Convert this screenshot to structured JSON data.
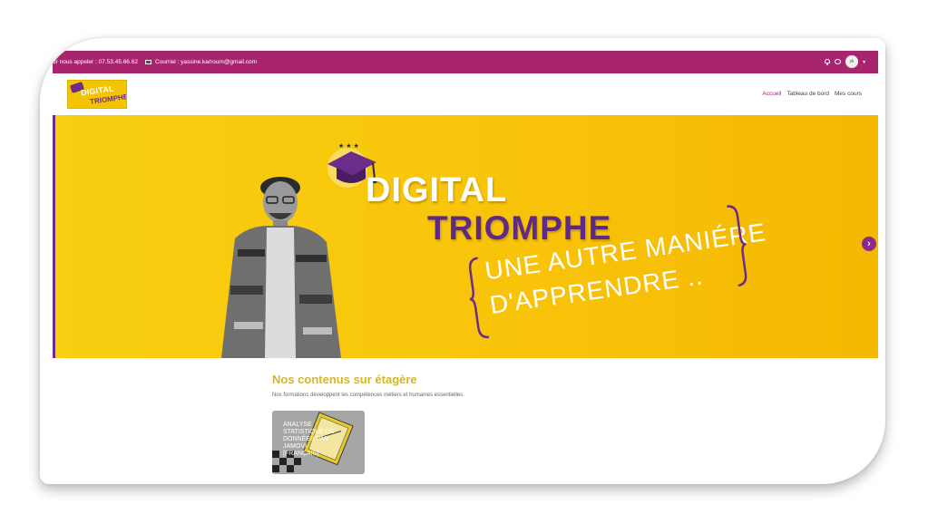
{
  "topbar": {
    "phone_text": "ur nous appeler : 07.53.45.66.62",
    "email_text": "Courriel : yassine.karroum@gmail.com",
    "avatar_initials": "yk",
    "bg_color": "#a8256e"
  },
  "logo": {
    "line1": "DIGITAL",
    "line2": "TRIOMPHE"
  },
  "nav": {
    "home": "Accueil",
    "dashboard": "Tableau de bord",
    "my_courses": "Mes cours",
    "active_color": "#a8256e"
  },
  "banner": {
    "word1": "DIGITAL",
    "word2": "TRIOMPHE",
    "tagline1": "UNE AUTRE MANIÉRE",
    "tagline2": "D'APPRENDRE ..",
    "bg_color": "#f8c40a",
    "accent_color": "#5e2a86"
  },
  "section": {
    "title": "Nos contenus sur étagère",
    "subtitle": "Nos formations développent les compétences métiers et humaines essentielles."
  },
  "course": {
    "title": "ANALYSE STATISTIQUE DE DONNÉES PAR JAMOVI [Français]"
  },
  "icons": {
    "notification": "bell-icon",
    "messages": "chat-icon",
    "email": "envelope-icon",
    "carousel_next": "chevron-right-icon"
  }
}
